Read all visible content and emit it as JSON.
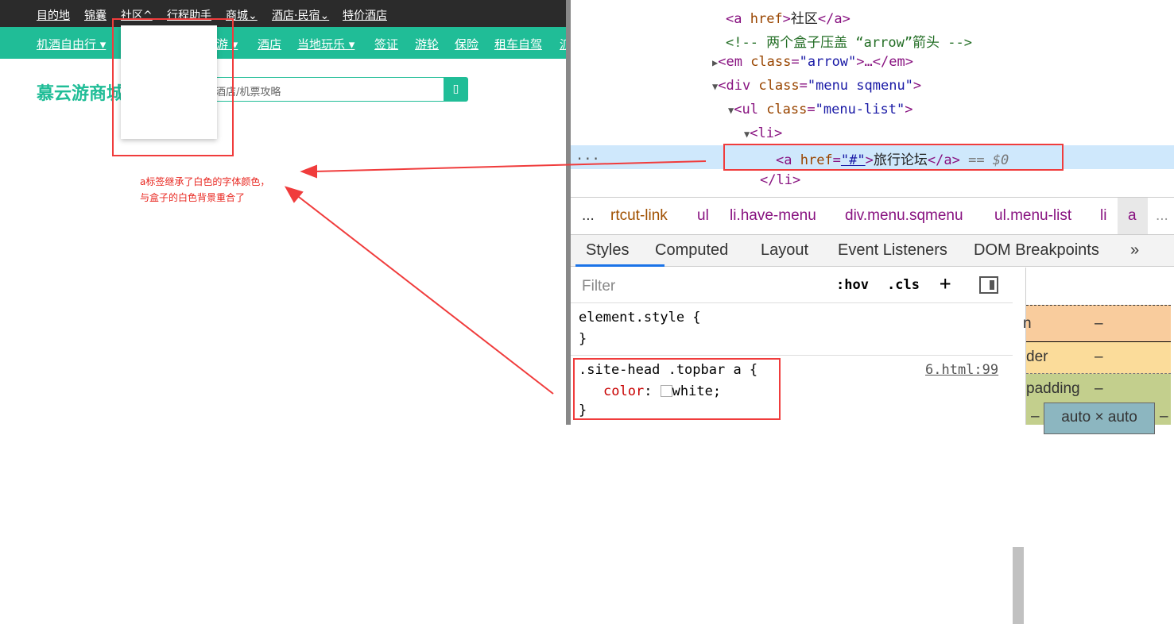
{
  "page": {
    "topbar": [
      "目的地",
      "锦囊",
      "社区^",
      "行程助手",
      "商城⌄",
      "酒店·民宿⌄",
      "特价酒店"
    ],
    "navbar": [
      "机酒自由行 ▾",
      "游 ▾",
      "酒店",
      "当地玩乐 ▾",
      "签证",
      "游轮",
      "保险",
      "租车自驾",
      "派"
    ],
    "logo": "慕云游商城",
    "search_placeholder": "酒店/机票攻略",
    "search_icon": "▯"
  },
  "annotation": {
    "line1": "a标签继承了白色的字体颜色，",
    "line2": "与盒子的白色背景重合了",
    "color": "#f03c3c"
  },
  "devtools": {
    "dom": [
      {
        "pre": "<a href>",
        "text": "社区",
        "post": "</a>"
      },
      {
        "comment": "<!-- 两个盒子压盖 “arrow”箭头 -->"
      },
      {
        "tri": "▶",
        "a": "<em ",
        "n": "class",
        "v": "\"arrow\"",
        "b": ">…</em>"
      },
      {
        "tri": "▼",
        "a": "<div ",
        "n": "class",
        "v": "\"menu sqmenu\"",
        "b": ">"
      },
      {
        "tri": "▼",
        "a": "<ul ",
        "n": "class",
        "v": "\"menu-list\"",
        "b": ">"
      },
      {
        "tri": "▼",
        "a": "<li>"
      },
      {
        "a": "<a ",
        "n": "href",
        "v": "\"#\"",
        "b": ">",
        "text": "旅行论坛",
        "c": "</a>",
        "sel": "== $0"
      },
      {
        "a": "</li>"
      }
    ],
    "dots": "...",
    "crumbs": [
      "...",
      "rtcut-link",
      "ul",
      "li.have-menu",
      "div.menu.sqmenu",
      "ul.menu-list",
      "li",
      "a",
      "..."
    ],
    "tabs": [
      "Styles",
      "Computed",
      "Layout",
      "Event Listeners",
      "DOM Breakpoints",
      "»"
    ],
    "filter_placeholder": "Filter",
    "hov": ":hov",
    "cls": ".cls",
    "plus": "+",
    "rules": [
      {
        "selector": "element.style {",
        "close": "}"
      },
      {
        "selector": ".site-head .topbar a {",
        "source": "6.html:99",
        "prop": "color",
        "value": "white;",
        "close": "}"
      }
    ],
    "boxmodel": {
      "margin": "n",
      "margin_val": "–",
      "border": "der",
      "border_val": "–",
      "padding": "padding",
      "padding_val": "–",
      "content": "auto × auto",
      "side": "–"
    }
  }
}
